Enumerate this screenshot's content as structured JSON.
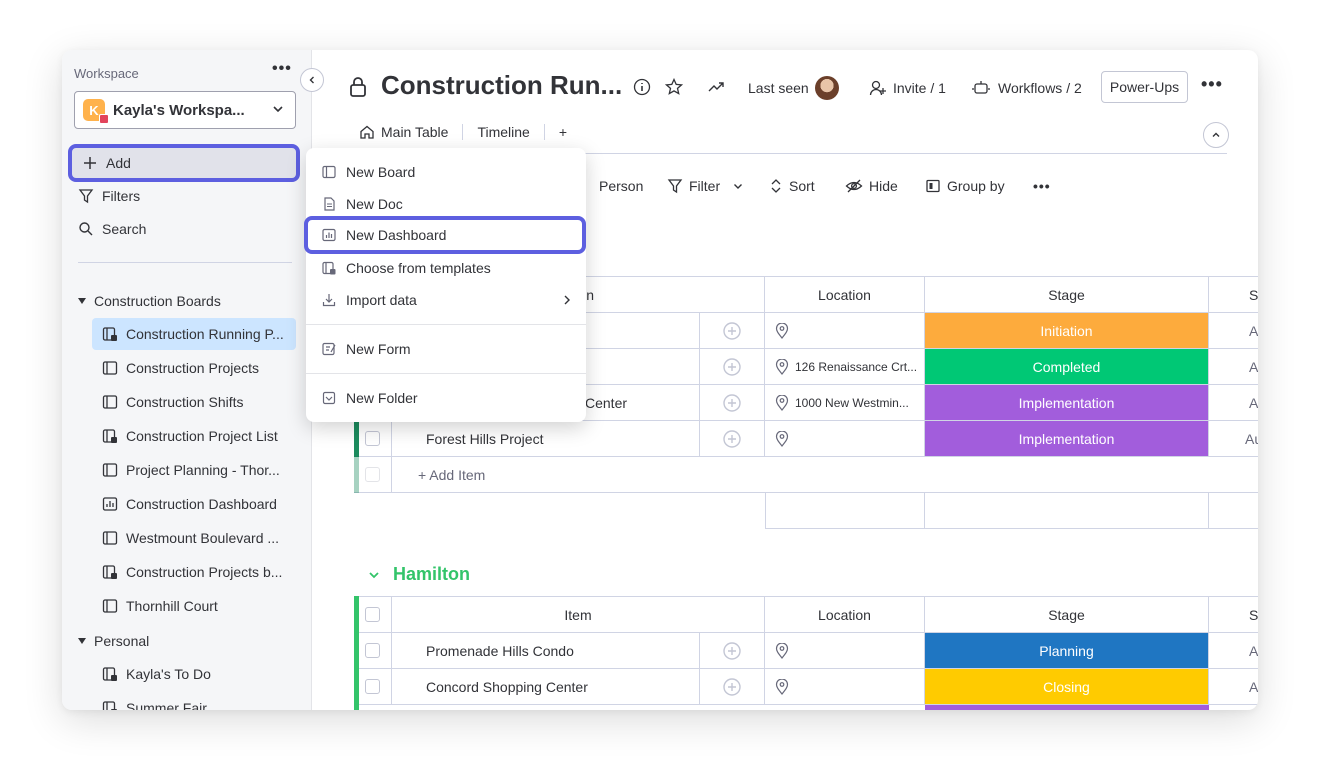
{
  "sidebar": {
    "workspace_label": "Workspace",
    "workspace_initial": "K",
    "workspace_name": "Kayla's Workspa...",
    "add_label": "Add",
    "filters_label": "Filters",
    "search_label": "Search",
    "folders": [
      {
        "label": "Construction Boards"
      },
      {
        "label": "Personal"
      }
    ],
    "items": [
      {
        "label": "Construction Running P..."
      },
      {
        "label": "Construction Projects"
      },
      {
        "label": "Construction Shifts"
      },
      {
        "label": "Construction Project List"
      },
      {
        "label": "Project Planning - Thor..."
      },
      {
        "label": "Construction Dashboard"
      },
      {
        "label": "Westmount Boulevard ..."
      },
      {
        "label": "Construction Projects b..."
      },
      {
        "label": "Thornhill Court"
      },
      {
        "label": "Kayla's To Do"
      },
      {
        "label": "Summer Fair"
      }
    ]
  },
  "header": {
    "title": "Construction Run...",
    "last_seen": "Last seen",
    "invite": "Invite / 1",
    "workflows": "Workflows / 2",
    "powerups": "Power-Ups"
  },
  "tabs": {
    "main_table": "Main Table",
    "timeline": "Timeline",
    "add": "+"
  },
  "toolbar": {
    "person": "Person",
    "filter": "Filter",
    "sort": "Sort",
    "hide": "Hide",
    "group_by": "Group by"
  },
  "dropdown": {
    "new_board": "New Board",
    "new_doc": "New Doc",
    "new_dashboard": "New Dashboard",
    "choose_templates": "Choose from templates",
    "import_data": "Import data",
    "new_form": "New Form",
    "new_folder": "New Folder"
  },
  "group1": {
    "header_partial": "n",
    "location_header": "Location",
    "stage_header": "Stage",
    "status_header_partial": "S",
    "add_item": "+ Add Item",
    "rows": [
      {
        "name": "",
        "location": "",
        "stage": "Initiation",
        "stage_color": "#fdab3d",
        "extra": "A"
      },
      {
        "name": "",
        "location": "126 Renaissance Crt...",
        "stage": "Completed",
        "stage_color": "#00c875",
        "extra": "A"
      },
      {
        "name": "Center",
        "location": "1000 New Westmin...",
        "stage": "Implementation",
        "stage_color": "#a25ddc",
        "extra": "A"
      },
      {
        "name": "Forest Hills Project",
        "location": "",
        "stage": "Implementation",
        "stage_color": "#a25ddc",
        "extra": "Au"
      }
    ]
  },
  "group2": {
    "title": "Hamilton",
    "color": "#33c46a",
    "item_header": "Item",
    "location_header": "Location",
    "stage_header": "Stage",
    "status_header_partial": "S",
    "rows": [
      {
        "name": "Promenade Hills Condo",
        "location": "",
        "stage": "Planning",
        "stage_color": "#1f76c2",
        "extra": "A"
      },
      {
        "name": "Concord Shopping Center",
        "location": "",
        "stage": "Closing",
        "stage_color": "#ffcb00",
        "extra": "A"
      }
    ]
  }
}
